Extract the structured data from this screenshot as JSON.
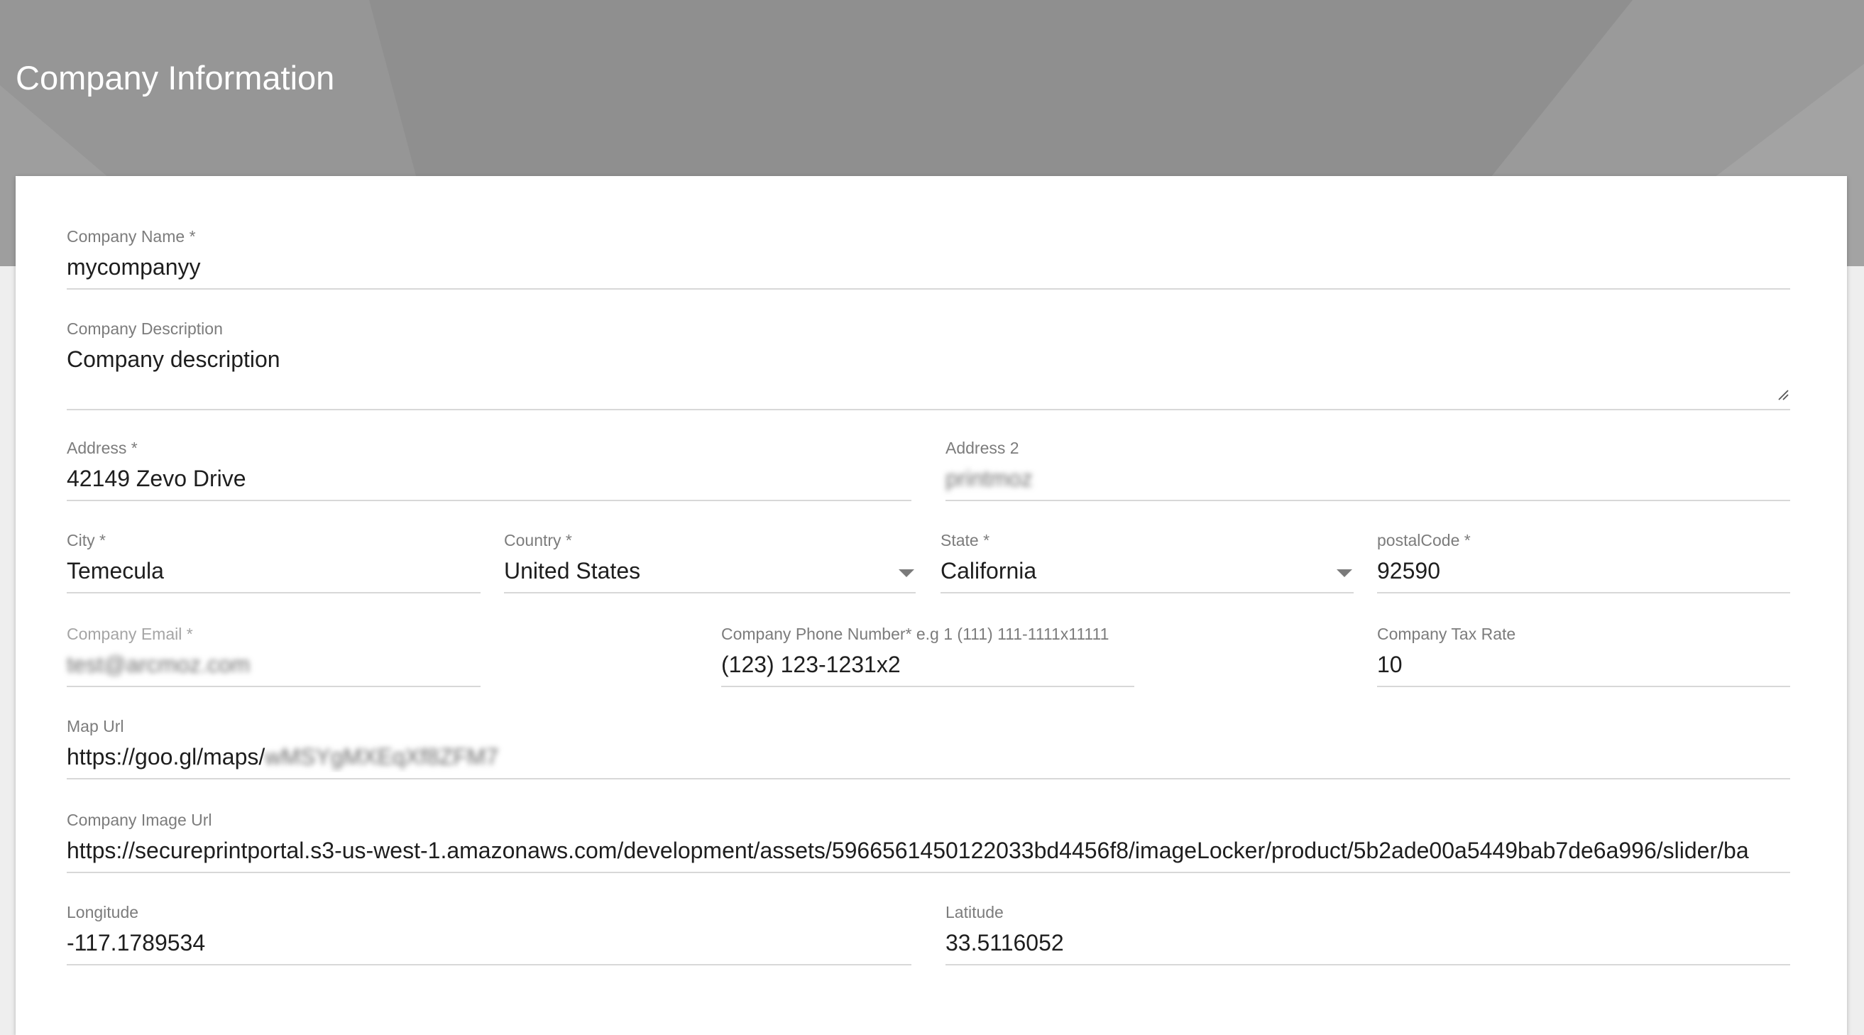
{
  "page": {
    "title": "Company Information"
  },
  "form": {
    "company_name": {
      "label": "Company Name *",
      "value": "mycompanyy"
    },
    "company_description": {
      "label": "Company Description",
      "value": "Company description"
    },
    "address": {
      "label": "Address *",
      "value": "42149  Zevo Drive"
    },
    "address2": {
      "label": "Address 2",
      "value": "printmoz"
    },
    "city": {
      "label": "City *",
      "value": "Temecula"
    },
    "country": {
      "label": "Country *",
      "value": "United States"
    },
    "state": {
      "label": "State *",
      "value": "California"
    },
    "postal_code": {
      "label": "postalCode *",
      "value": "92590"
    },
    "company_email": {
      "label": "Company Email *",
      "value": "test@arcmoz.com"
    },
    "company_phone": {
      "label": "Company Phone Number* e.g 1 (111) 111-1111x11111",
      "value": "(123) 123-1231x2"
    },
    "tax_rate": {
      "label": "Company Tax Rate",
      "value": "10"
    },
    "map_url": {
      "label": "Map Url",
      "value_visible": "https://goo.gl/maps/",
      "value_blurred": "wMSYgMXEqXf8ZFM7"
    },
    "image_url": {
      "label": "Company Image Url",
      "value": "https://secureprintportal.s3-us-west-1.amazonaws.com/development/assets/5966561450122033bd4456f8/imageLocker/product/5b2ade00a5449bab7de6a996/slider/ba"
    },
    "longitude": {
      "label": "Longitude",
      "value": "-117.1789534"
    },
    "latitude": {
      "label": "Latitude",
      "value": "33.5116052"
    }
  },
  "icons": {
    "dropdown": "chevron-down-icon",
    "resize": "resize-handle-icon"
  },
  "colors": {
    "header": "#8f8f8f",
    "card": "#ffffff",
    "label": "#7c7c7c",
    "value": "#1e1e1e",
    "underline": "#d8d8d8"
  }
}
